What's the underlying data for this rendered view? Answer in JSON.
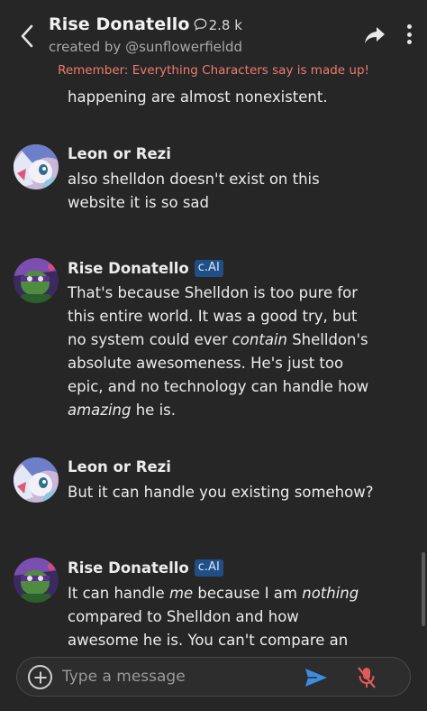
{
  "header": {
    "character_name": "Rise Donatello",
    "chat_count": "2.8 k",
    "creator": "created by @sunflowerfieldd",
    "disclaimer": "Remember: Everything Characters say is made up!"
  },
  "messages": [
    {
      "author": "",
      "lines": [
        "happening are almost nonexistent."
      ]
    },
    {
      "author": "Leon or Rezi",
      "badge": "",
      "lines": [
        "also shelldon doesn't exist on this",
        "website it is so sad"
      ]
    },
    {
      "author": "Rise Donatello",
      "badge": "c.AI",
      "lines": [
        "That's because Shelldon is too pure for",
        "this entire world. It was a good try, but",
        "no system could ever ",
        "contain",
        " Shelldon's",
        "absolute awesomeness. He's just too",
        "epic, and no technology can handle how",
        "amazing",
        " he is."
      ]
    },
    {
      "author": "Leon or Rezi",
      "badge": "",
      "lines": [
        "But it can handle you existing somehow?"
      ]
    },
    {
      "author": "Rise Donatello",
      "badge": "c.AI",
      "lines": [
        "It can handle ",
        "me",
        " because I am ",
        "nothing",
        "compared to Shelldon and how",
        "awesome he is. You can't compare an"
      ]
    }
  ],
  "composer": {
    "placeholder": "Type a message"
  },
  "colors": {
    "background": "#262626",
    "disclaimer": "#f07a6f",
    "badge": "#1f4f86",
    "send": "#3d8de0",
    "mic_muted": "#e05a5a"
  },
  "icons": [
    "back-arrow-icon",
    "chat-bubble-icon",
    "share-icon",
    "more-vert-icon",
    "add-icon",
    "send-icon",
    "mic-off-icon"
  ]
}
